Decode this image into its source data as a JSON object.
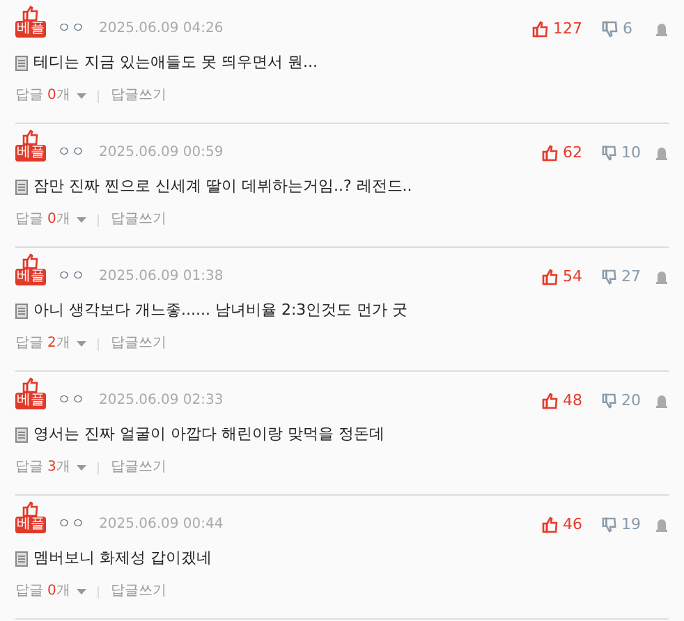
{
  "comments": [
    {
      "badge": "베플",
      "author": "ㅇㅇ",
      "date": "2025.06.09 04:26",
      "text": "테디는 지금 있는애들도 못 띄우면서 뭔...",
      "likes": "127",
      "dislikes": "6",
      "reply_label": "답글",
      "reply_count": "0",
      "reply_unit": "개",
      "write_reply": "답글쓰기"
    },
    {
      "badge": "베플",
      "author": "ㅇㅇ",
      "date": "2025.06.09 00:59",
      "text": "잠만 진짜 찐으로 신세계 딸이 데뷔하는거임..? 레전드..",
      "likes": "62",
      "dislikes": "10",
      "reply_label": "답글",
      "reply_count": "0",
      "reply_unit": "개",
      "write_reply": "답글쓰기"
    },
    {
      "badge": "베플",
      "author": "ㅇㅇ",
      "date": "2025.06.09 01:38",
      "text": "아니 생각보다 개느좋...... 남녀비율 2:3인것도 먼가 굿",
      "likes": "54",
      "dislikes": "27",
      "reply_label": "답글",
      "reply_count": "2",
      "reply_unit": "개",
      "write_reply": "답글쓰기"
    },
    {
      "badge": "베플",
      "author": "ㅇㅇ",
      "date": "2025.06.09 02:33",
      "text": "영서는 진짜 얼굴이 아깝다 해린이랑 맞먹을 정돈데",
      "likes": "48",
      "dislikes": "20",
      "reply_label": "답글",
      "reply_count": "3",
      "reply_unit": "개",
      "write_reply": "답글쓰기"
    },
    {
      "badge": "베플",
      "author": "ㅇㅇ",
      "date": "2025.06.09 00:44",
      "text": "멤버보니 화제성 갑이겠네",
      "likes": "46",
      "dislikes": "19",
      "reply_label": "답글",
      "reply_count": "0",
      "reply_unit": "개",
      "write_reply": "답글쓰기"
    }
  ]
}
